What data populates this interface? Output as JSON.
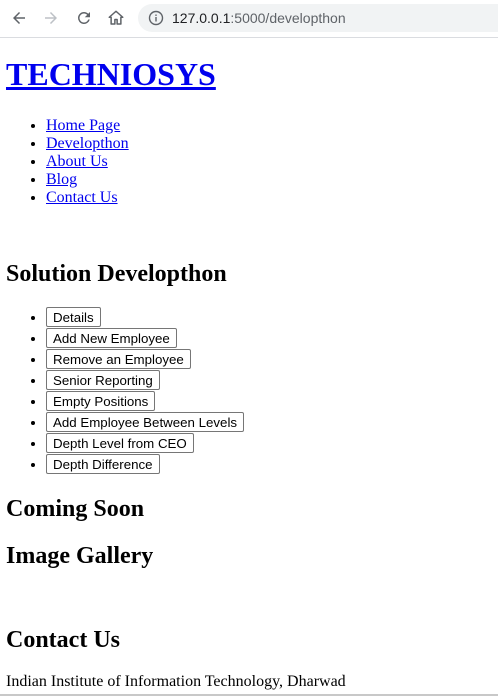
{
  "browser": {
    "url_host": "127.0.0.1",
    "url_path": ":5000/developthon"
  },
  "site": {
    "title": "TECHNIOSYS"
  },
  "nav": {
    "items": [
      {
        "label": "Home Page"
      },
      {
        "label": "Developthon"
      },
      {
        "label": "About Us"
      },
      {
        "label": "Blog"
      },
      {
        "label": "Contact Us"
      }
    ]
  },
  "solution": {
    "heading": "Solution Developthon",
    "buttons": [
      {
        "label": "Details"
      },
      {
        "label": "Add New Employee"
      },
      {
        "label": "Remove an Employee"
      },
      {
        "label": "Senior Reporting"
      },
      {
        "label": "Empty Positions"
      },
      {
        "label": "Add Employee Between Levels"
      },
      {
        "label": "Depth Level from CEO"
      },
      {
        "label": "Depth Difference"
      }
    ]
  },
  "coming_soon": {
    "heading": "Coming Soon"
  },
  "gallery": {
    "heading": "Image Gallery"
  },
  "contact": {
    "heading": "Contact Us",
    "address": "Indian Institute of Information Technology, Dharwad"
  }
}
